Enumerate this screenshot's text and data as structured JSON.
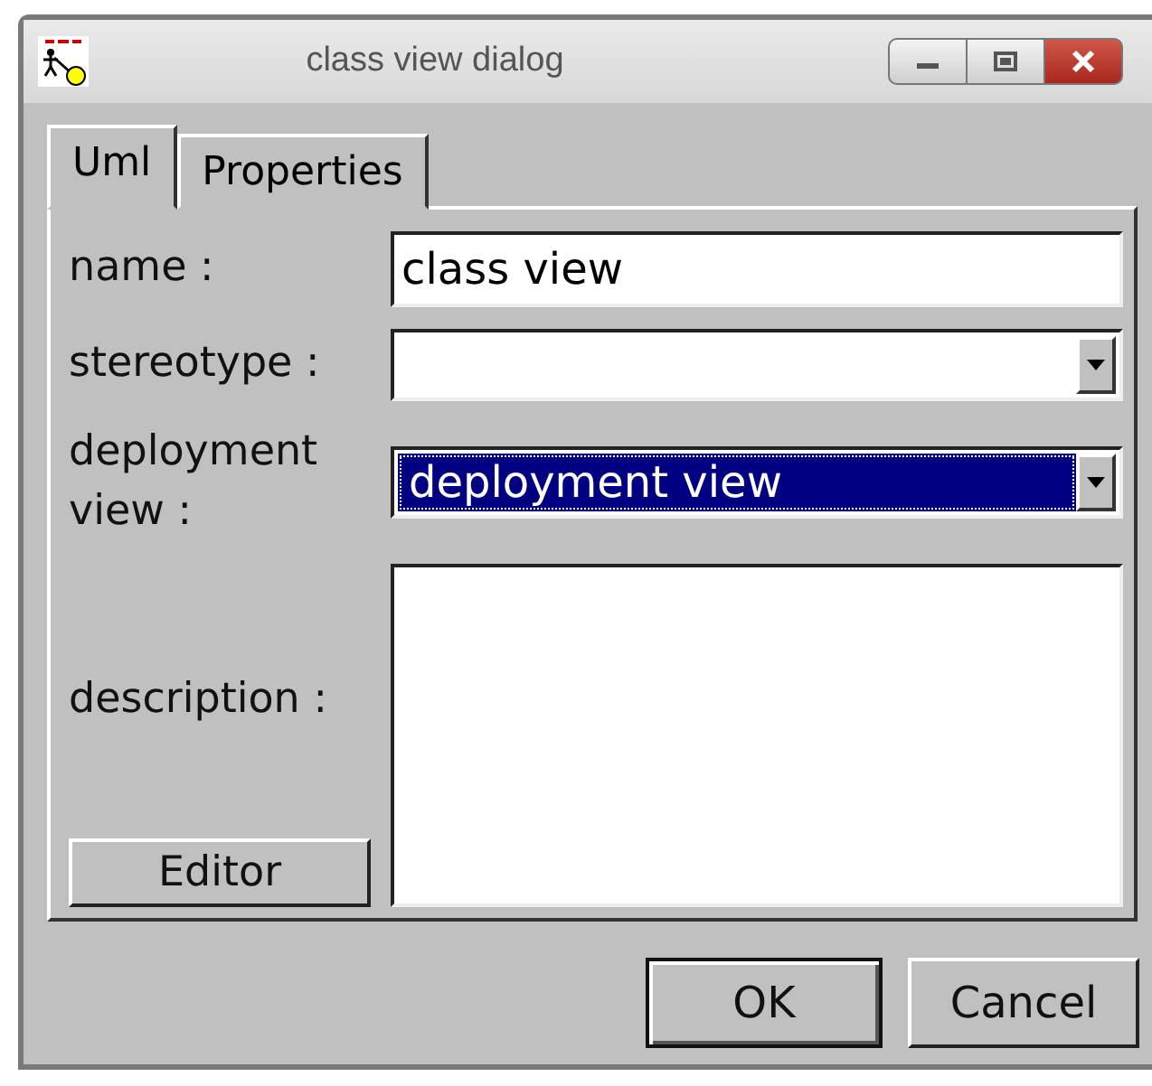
{
  "window": {
    "title": "class view dialog"
  },
  "tabs": [
    {
      "label": "Uml",
      "selected": true
    },
    {
      "label": "Properties",
      "selected": false
    }
  ],
  "fields": [
    {
      "kind": "text",
      "label": "name :",
      "value": "class view"
    },
    {
      "kind": "combo",
      "label": "stereotype :",
      "selected": false
    },
    {
      "kind": "combo",
      "label": "deployment view :",
      "value": "deployment view",
      "selected": true
    },
    {
      "kind": "textarea",
      "label": "description :",
      "button": "Editor"
    }
  ],
  "buttons": [
    {
      "label": "OK",
      "default": true
    },
    {
      "label": "Cancel",
      "default": false
    }
  ]
}
